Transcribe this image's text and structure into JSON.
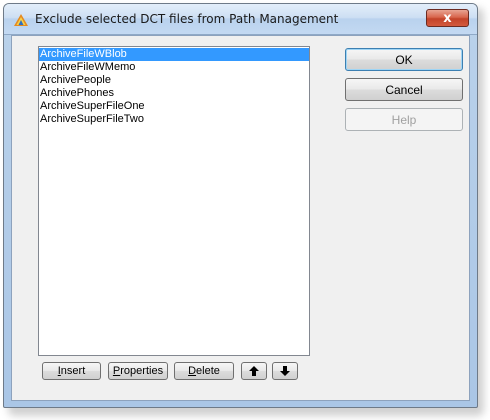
{
  "window": {
    "title": "Exclude selected DCT files from Path Management",
    "close_glyph": "x"
  },
  "list": {
    "items": [
      {
        "label": "ArchiveFileWBlob",
        "selected": true
      },
      {
        "label": "ArchiveFileWMemo",
        "selected": false
      },
      {
        "label": "ArchivePeople",
        "selected": false
      },
      {
        "label": "ArchivePhones",
        "selected": false
      },
      {
        "label": "ArchiveSuperFileOne",
        "selected": false
      },
      {
        "label": "ArchiveSuperFileTwo",
        "selected": false
      }
    ]
  },
  "buttons": {
    "ok": "OK",
    "cancel": "Cancel",
    "help": "Help",
    "insert_first": "I",
    "insert_rest": "nsert",
    "properties_first": "P",
    "properties_rest": "roperties",
    "delete_first": "D",
    "delete_rest": "elete",
    "move_up_icon": "arrow-up-icon",
    "move_down_icon": "arrow-down-icon"
  },
  "colors": {
    "selection": "#3399ff",
    "client_bg": "#f0f0f0",
    "frame": "#b9d1ea",
    "close": "#c3432a"
  }
}
